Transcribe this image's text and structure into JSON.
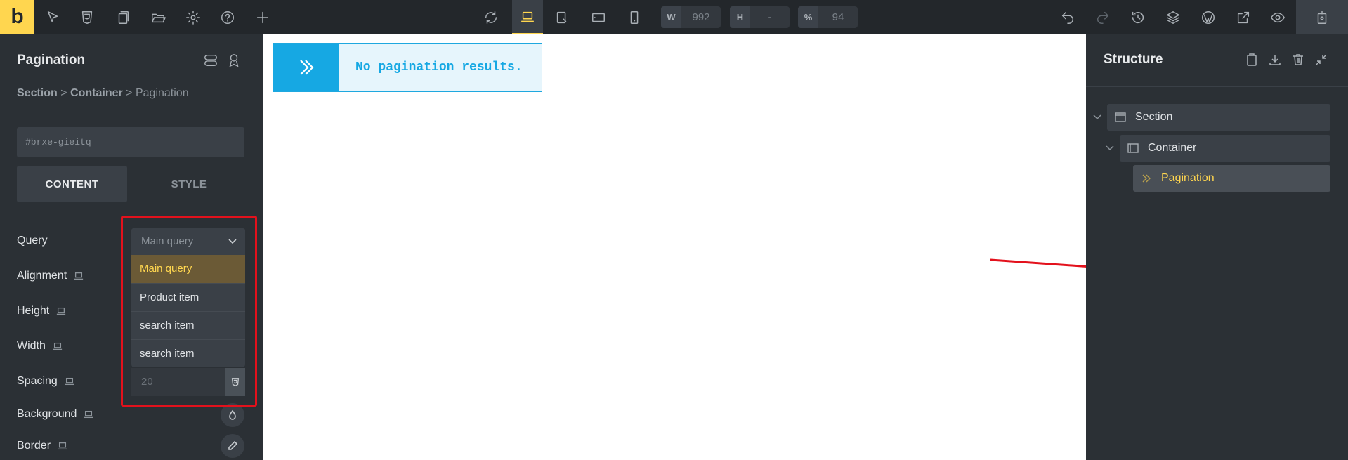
{
  "topbar": {
    "logo": "b",
    "width_label": "W",
    "width_value": "992",
    "height_label": "H",
    "height_value": "-",
    "zoom_label": "%",
    "zoom_value": "94"
  },
  "left_panel": {
    "title": "Pagination",
    "breadcrumb": {
      "section": "Section",
      "sep1": ">",
      "container": "Container",
      "sep2": ">",
      "current": "Pagination"
    },
    "element_id": "#brxe-gieitq",
    "tabs": {
      "content": "CONTENT",
      "style": "STYLE"
    },
    "controls": {
      "query": "Query",
      "alignment": "Alignment",
      "height": "Height",
      "width": "Width",
      "spacing": "Spacing",
      "background": "Background",
      "border": "Border"
    },
    "query_select": {
      "placeholder": "Main query",
      "options": [
        "Main query",
        "Product item",
        "search item",
        "search item"
      ]
    },
    "spacing_placeholder": "20"
  },
  "canvas": {
    "notice_text": "No pagination results."
  },
  "right_panel": {
    "title": "Structure",
    "tree": {
      "section": "Section",
      "container": "Container",
      "pagination": "Pagination"
    }
  },
  "colors": {
    "accent": "#ffd64f",
    "notice_blue": "#16a8e3",
    "annotation_red": "#e3111c"
  }
}
